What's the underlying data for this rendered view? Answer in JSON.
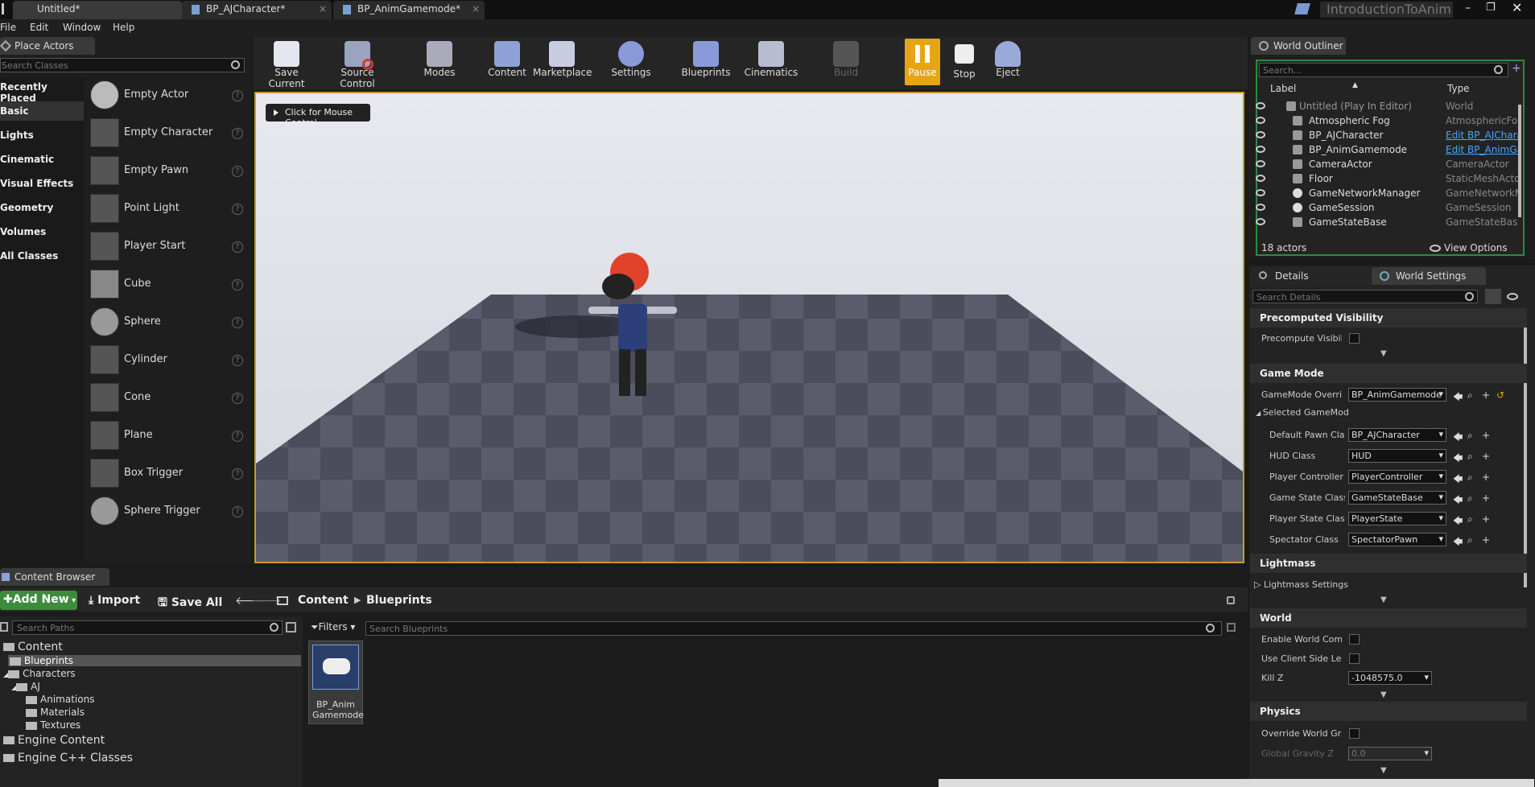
{
  "tabs": [
    {
      "label": "Untitled*",
      "icon": "ue-logo-icon"
    },
    {
      "label": "BP_AJCharacter*",
      "icon": "blueprint-icon"
    },
    {
      "label": "BP_AnimGamemode*",
      "icon": "blueprint-icon"
    }
  ],
  "project_name": "IntroductionToAnim",
  "menu": [
    "File",
    "Edit",
    "Window",
    "Help"
  ],
  "place_actors": {
    "title": "Place Actors",
    "search_placeholder": "Search Classes",
    "categories": [
      "Recently Placed",
      "Basic",
      "Lights",
      "Cinematic",
      "Visual Effects",
      "Geometry",
      "Volumes",
      "All Classes"
    ],
    "items": [
      "Empty Actor",
      "Empty Character",
      "Empty Pawn",
      "Point Light",
      "Player Start",
      "Cube",
      "Sphere",
      "Cylinder",
      "Cone",
      "Plane",
      "Box Trigger",
      "Sphere Trigger"
    ]
  },
  "toolbar": [
    {
      "label": "Save Current",
      "icon": "save-icon"
    },
    {
      "label": "Source Control",
      "icon": "source-control-icon"
    },
    {
      "label": "Modes",
      "icon": "modes-icon"
    },
    {
      "label": "Content",
      "icon": "content-icon"
    },
    {
      "label": "Marketplace",
      "icon": "marketplace-icon"
    },
    {
      "label": "Settings",
      "icon": "settings-icon"
    },
    {
      "label": "Blueprints",
      "icon": "blueprints-icon"
    },
    {
      "label": "Cinematics",
      "icon": "cinematics-icon"
    },
    {
      "label": "Build",
      "icon": "build-icon"
    },
    {
      "label": "Pause",
      "icon": "pause-icon"
    },
    {
      "label": "Stop",
      "icon": "stop-icon"
    },
    {
      "label": "Eject",
      "icon": "eject-icon"
    }
  ],
  "viewport": {
    "mouse_control_label": "Click for Mouse Control"
  },
  "outliner": {
    "title": "World Outliner",
    "search_placeholder": "Search...",
    "col_label": "Label",
    "col_type": "Type",
    "rows": [
      {
        "name": "Untitled (Play In Editor)",
        "type": "World",
        "link": false
      },
      {
        "name": "Atmospheric Fog",
        "type": "AtmosphericFog",
        "link": false
      },
      {
        "name": "BP_AJCharacter",
        "type": "Edit BP_AJCharac",
        "link": true
      },
      {
        "name": "BP_AnimGamemode",
        "type": "Edit BP_AnimGa",
        "link": true
      },
      {
        "name": "CameraActor",
        "type": "CameraActor",
        "link": false
      },
      {
        "name": "Floor",
        "type": "StaticMeshActor",
        "link": false
      },
      {
        "name": "GameNetworkManager",
        "type": "GameNetworkMa",
        "link": false
      },
      {
        "name": "GameSession",
        "type": "GameSession",
        "link": false
      },
      {
        "name": "GameStateBase",
        "type": "GameStateBase",
        "link": false
      }
    ],
    "actor_count": "18 actors",
    "view_options": "View Options"
  },
  "details": {
    "tab_details": "Details",
    "tab_world": "World Settings",
    "search_placeholder": "Search Details",
    "sec_precomputed": "Precomputed Visibility",
    "precompute_label": "Precompute Visibilit",
    "sec_gamemode": "Game Mode",
    "gamemode_override_label": "GameMode Overrid",
    "gamemode_override_value": "BP_AnimGamemode",
    "selected_gamemode": "Selected GameMod",
    "gm_rows": [
      {
        "label": "Default Pawn Clas",
        "value": "BP_AJCharacter"
      },
      {
        "label": "HUD Class",
        "value": "HUD"
      },
      {
        "label": "Player Controller (",
        "value": "PlayerController"
      },
      {
        "label": "Game State Class",
        "value": "GameStateBase"
      },
      {
        "label": "Player State Clas:",
        "value": "PlayerState"
      },
      {
        "label": "Spectator Class",
        "value": "SpectatorPawn"
      }
    ],
    "sec_lightmass": "Lightmass",
    "lightmass_settings": "Lightmass Settings",
    "sec_world": "World",
    "enable_world_comp": "Enable World Compo",
    "use_client_side": "Use Client Side Leve",
    "kill_z_label": "Kill Z",
    "kill_z_value": "-1048575.0",
    "sec_physics": "Physics",
    "override_gravity": "Override World Grav",
    "global_gravity_label": "Global Gravity Z",
    "global_gravity_value": "0.0"
  },
  "content_browser": {
    "title": "Content Browser",
    "add_new": "Add New",
    "import": "Import",
    "save_all": "Save All",
    "path": [
      "Content",
      "Blueprints"
    ],
    "search_paths_placeholder": "Search Paths",
    "filters": "Filters",
    "search_assets_placeholder": "Search Blueprints",
    "tree": [
      {
        "label": "Content",
        "indent": 0
      },
      {
        "label": "Blueprints",
        "indent": 1
      },
      {
        "label": "Characters",
        "indent": 1
      },
      {
        "label": "AJ",
        "indent": 2
      },
      {
        "label": "Animations",
        "indent": 3
      },
      {
        "label": "Materials",
        "indent": 3
      },
      {
        "label": "Textures",
        "indent": 3
      },
      {
        "label": "Engine Content",
        "indent": 0
      },
      {
        "label": "Engine C++ Classes",
        "indent": 0
      }
    ],
    "asset_name": "BP_Anim Gamemode"
  }
}
